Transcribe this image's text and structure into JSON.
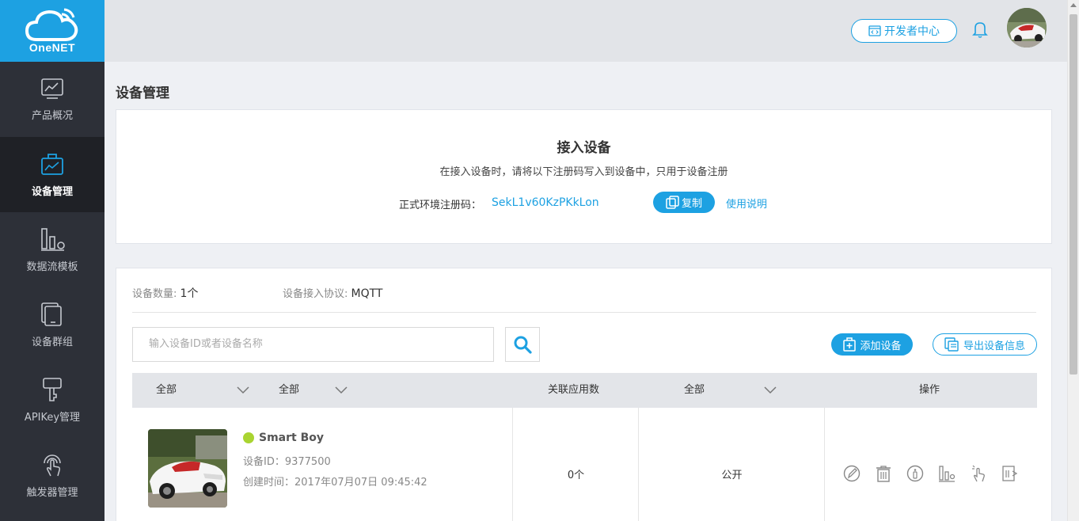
{
  "brand": {
    "name": "OneNET"
  },
  "sidebar": {
    "items": [
      {
        "label": "产品概况",
        "icon": "line-chart-icon",
        "active": false
      },
      {
        "label": "设备管理",
        "icon": "device-icon",
        "active": true
      },
      {
        "label": "数据流模板",
        "icon": "bar-chart-icon",
        "active": false
      },
      {
        "label": "设备群组",
        "icon": "device-group-icon",
        "active": false
      },
      {
        "label": "APIKey管理",
        "icon": "key-icon",
        "active": false
      },
      {
        "label": "触发器管理",
        "icon": "touch-trigger-icon",
        "active": false
      }
    ]
  },
  "header": {
    "dev_center_label": "开发者中心",
    "icons": [
      "code-icon",
      "bell-icon",
      "avatar"
    ]
  },
  "page": {
    "title": "设备管理"
  },
  "access": {
    "title": "接入设备",
    "description": "在接入设备时，请将以下注册码写入到设备中，只用于设备注册",
    "code_label": "正式环境注册码：",
    "code_value": "SekL1v60KzPKkLon",
    "copy_label": "复制",
    "usage_link": "使用说明"
  },
  "devices": {
    "count_label": "设备数量:",
    "count_value": "1个",
    "protocol_label": "设备接入协议:",
    "protocol_value": "MQTT",
    "search_placeholder": "输入设备ID或者设备名称",
    "add_label": "添加设备",
    "export_label": "导出设备信息",
    "table_headers": {
      "filter1": "全部",
      "filter2": "全部",
      "apps": "关联应用数",
      "filter3": "全部",
      "actions": "操作"
    },
    "rows": [
      {
        "name": "Smart Boy",
        "status_color": "#a9d431",
        "id_text": "设备ID：9377500",
        "created_text": "创建时间：2017年07月07日 09:45:42",
        "apps": "0个",
        "visibility": "公开"
      }
    ],
    "action_icons": [
      "edit-icon",
      "delete-icon",
      "info-icon",
      "datastream-icon",
      "debug-touch-icon",
      "export-icon"
    ]
  },
  "colors": {
    "accent": "#1da1e2",
    "sidebar": "#2d3038",
    "online": "#a9d431"
  }
}
